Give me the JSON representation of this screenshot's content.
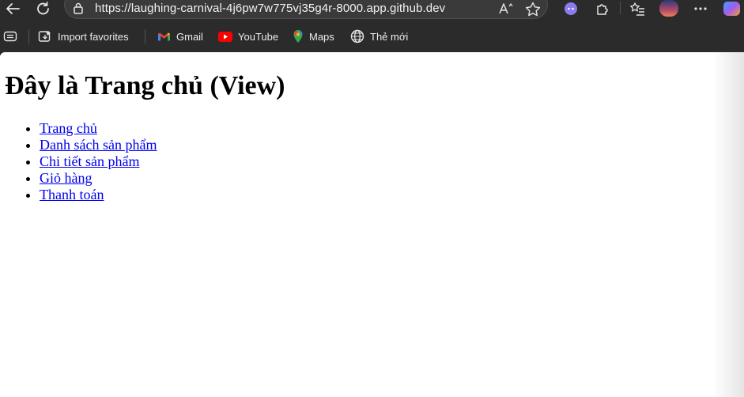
{
  "browser": {
    "url": "https://laughing-carnival-4j6pw7w775vj35g4r-8000.app.github.dev",
    "bookmarks": [
      {
        "label": "Import favorites",
        "icon": "import-favorites-icon"
      },
      {
        "label": "Gmail",
        "icon": "gmail-icon"
      },
      {
        "label": "YouTube",
        "icon": "youtube-icon"
      },
      {
        "label": "Maps",
        "icon": "maps-icon"
      },
      {
        "label": "Thẻ mới",
        "icon": "globe-icon"
      }
    ],
    "colors": {
      "chrome": "#2b2b2b",
      "link": "#0000ee",
      "youtube": "#ff0000"
    }
  },
  "page": {
    "title": "Đây là Trang chủ (View)",
    "nav_links": [
      "Trang chủ",
      "Danh sách sản phẩm",
      "Chi tiết sản phẩm",
      "Giỏ hàng",
      "Thanh toán"
    ]
  }
}
